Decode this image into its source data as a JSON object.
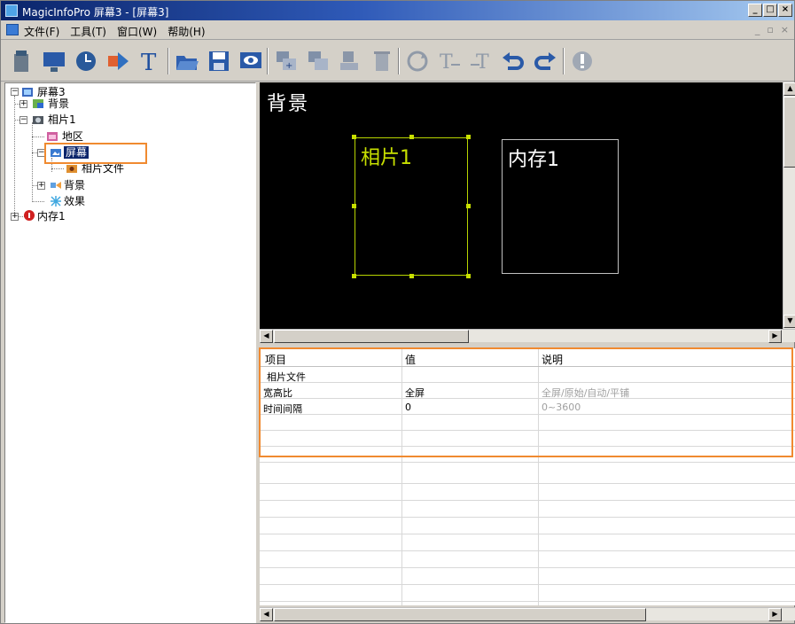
{
  "window": {
    "title": "MagicInfoPro 屏幕3 - [屏幕3]",
    "controls": [
      "_",
      "□",
      "×"
    ]
  },
  "menubar": {
    "items": [
      "文件(F)",
      "工具(T)",
      "窗口(W)",
      "帮助(H)"
    ],
    "mdi_controls": [
      "_",
      "▫",
      "×"
    ]
  },
  "toolbar": {
    "buttons": [
      "new-screen",
      "monitor",
      "clock",
      "transfer",
      "text",
      "open-folder",
      "save",
      "preview",
      "add-layer",
      "copy-layer",
      "stamp",
      "delete",
      "refresh",
      "text-align-left",
      "text-align-right",
      "undo",
      "redo",
      "info"
    ]
  },
  "tree": {
    "root": "屏幕3",
    "nodes": [
      {
        "label": "背景",
        "level": 1
      },
      {
        "label": "相片1",
        "level": 1
      },
      {
        "label": "地区",
        "level": 2
      },
      {
        "label": "屏幕",
        "level": 2,
        "selected": true
      },
      {
        "label": "相片文件",
        "level": 3
      },
      {
        "label": "背景",
        "level": 2
      },
      {
        "label": "效果",
        "level": 2
      },
      {
        "label": "内存1",
        "level": 1
      }
    ]
  },
  "canvas": {
    "background_label": "背景",
    "photo_label": "相片1",
    "memory_label": "内存1",
    "accent_color": "#c8e000"
  },
  "grid": {
    "headers": [
      "项目",
      "值",
      "说明"
    ],
    "rows": [
      {
        "item": "相片文件",
        "value": "",
        "desc": ""
      },
      {
        "item": "宽高比",
        "value": "全屏",
        "desc": "全屏/原始/自动/平铺"
      },
      {
        "item": "时间间隔",
        "value": "0",
        "desc": "0~3600"
      }
    ]
  },
  "highlight_color": "#f08a30"
}
